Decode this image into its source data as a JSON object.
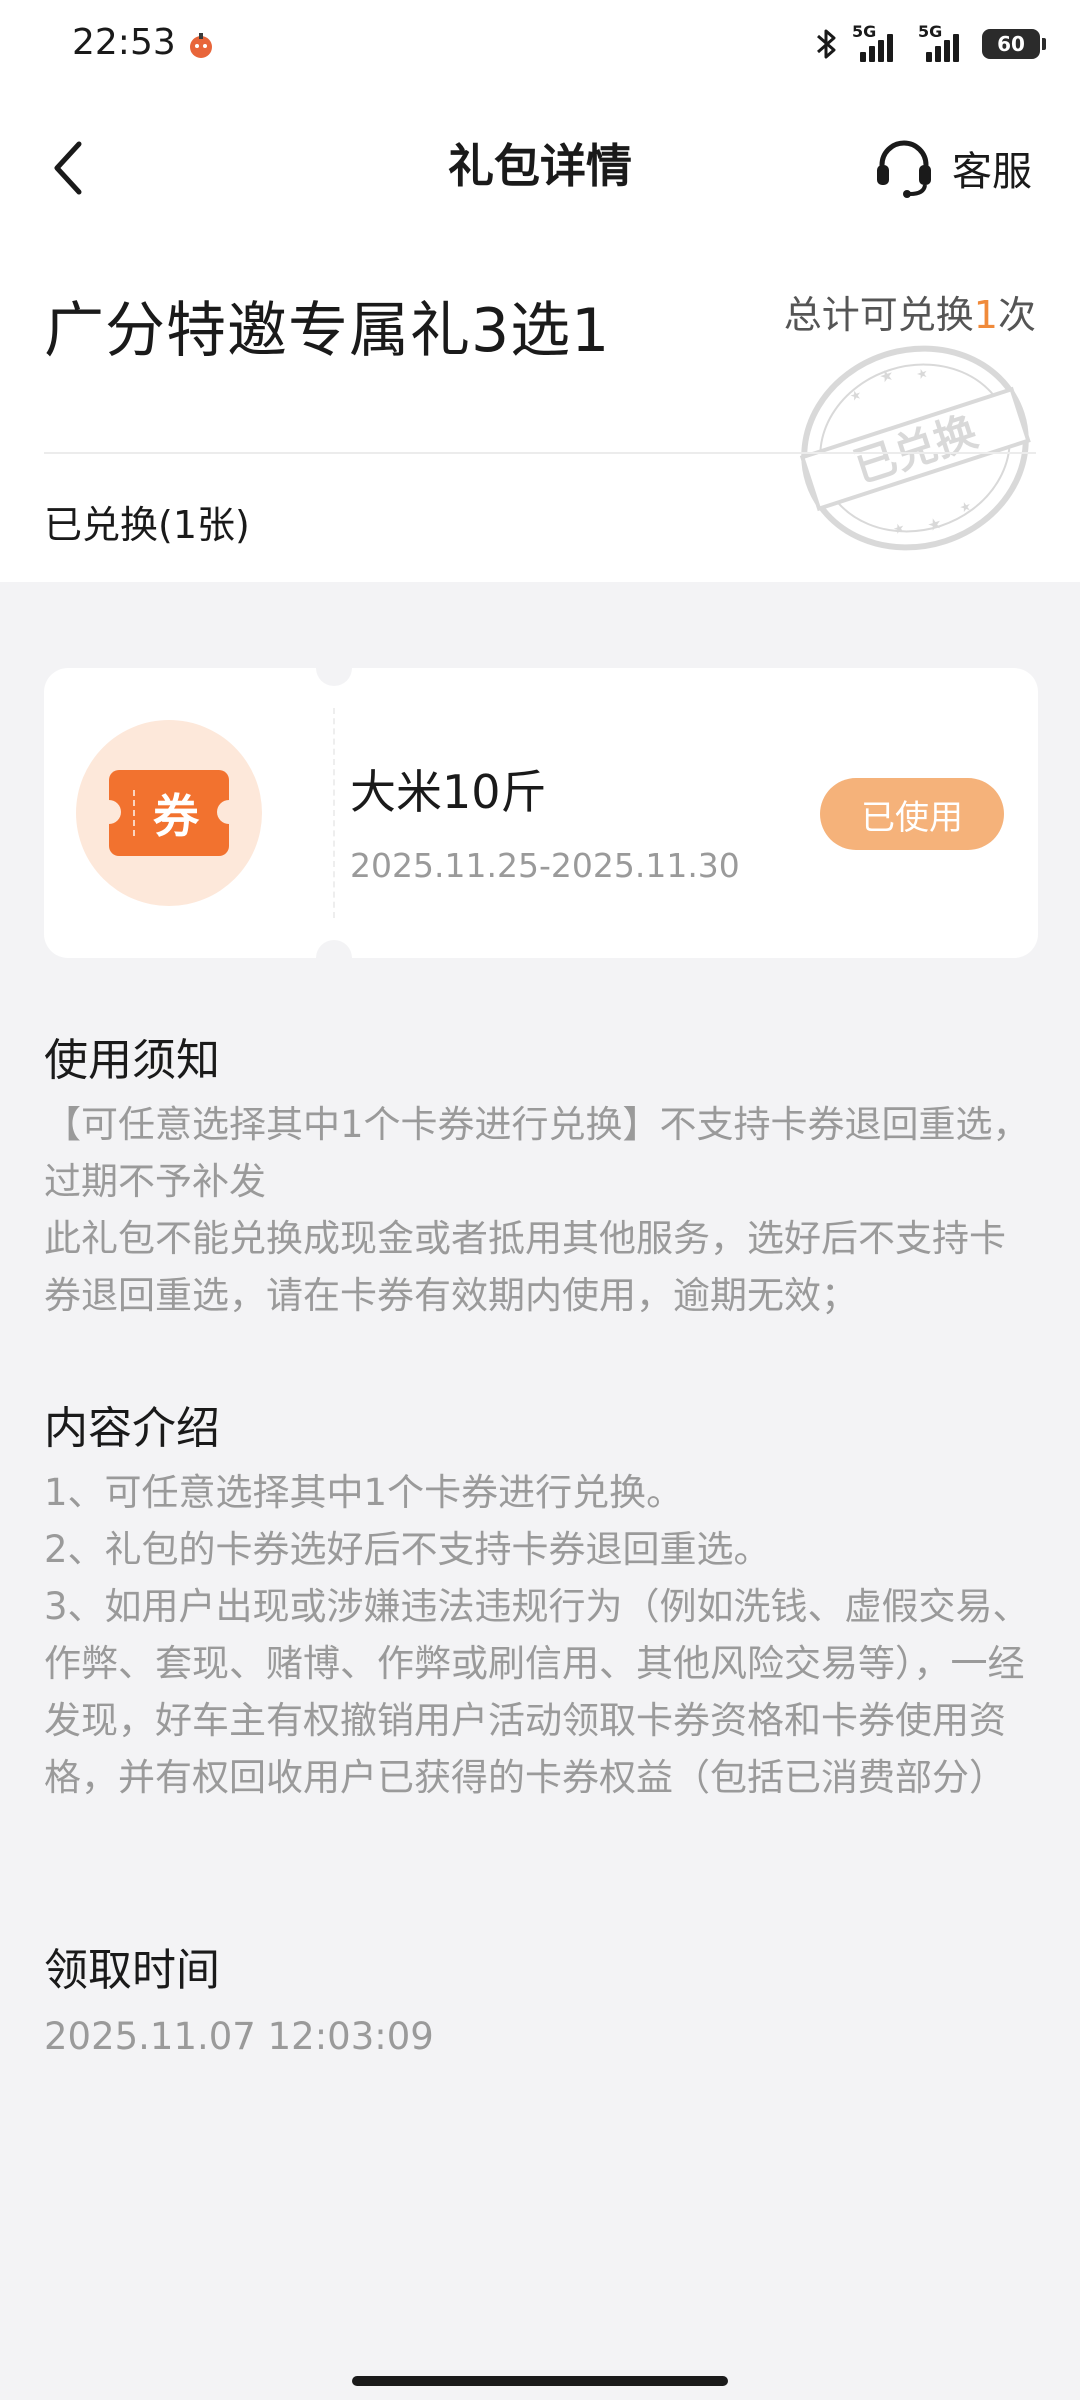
{
  "status_bar": {
    "time": "22:53",
    "network_left": "5G",
    "network_right": "5G",
    "battery": "60"
  },
  "nav": {
    "title": "礼包详情",
    "service_label": "客服"
  },
  "gift": {
    "title": "广分特邀专属礼3选1",
    "total_prefix": "总计可兑换",
    "total_count": "1",
    "total_suffix": "次",
    "stamp_text": "已兑换",
    "redeemed_label": "已兑换(1张)"
  },
  "coupon": {
    "icon_text": "券",
    "name": "大米10斤",
    "validity": "2025.11.25-2025.11.30",
    "status_label": "已使用"
  },
  "usage_notice": {
    "title": "使用须知",
    "lines": [
      "【可任意选择其中1个卡券进行兑换】不支持卡券退回重选，过期不予补发",
      "此礼包不能兑换成现金或者抵用其他服务，选好后不支持卡券退回重选，请在卡券有效期内使用，逾期无效；"
    ]
  },
  "content_intro": {
    "title": "内容介绍",
    "lines": [
      "1、可任意选择其中1个卡券进行兑换。",
      "2、礼包的卡券选好后不支持卡券退回重选。",
      "3、如用户出现或涉嫌违法违规行为（例如洗钱、虚假交易、作弊、套现、赌博、作弊或刷信用、其他风险交易等），一经发现，好车主有权撤销用户活动领取卡券资格和卡券使用资格，并有权回收用户已获得的卡券权益（包括已消费部分）"
    ]
  },
  "claim_time": {
    "title": "领取时间",
    "value": "2025.11.07 12:03:09"
  },
  "colors": {
    "accent": "#f08a3a",
    "used_button": "#f5b27a",
    "ticket": "#f2722f",
    "icon_bg": "#fde8da",
    "page_bg": "#f3f3f5"
  },
  "icons": {
    "back": "chevron-left-icon",
    "service": "headset-icon",
    "bluetooth": "bluetooth-icon",
    "coupon": "ticket-icon"
  }
}
